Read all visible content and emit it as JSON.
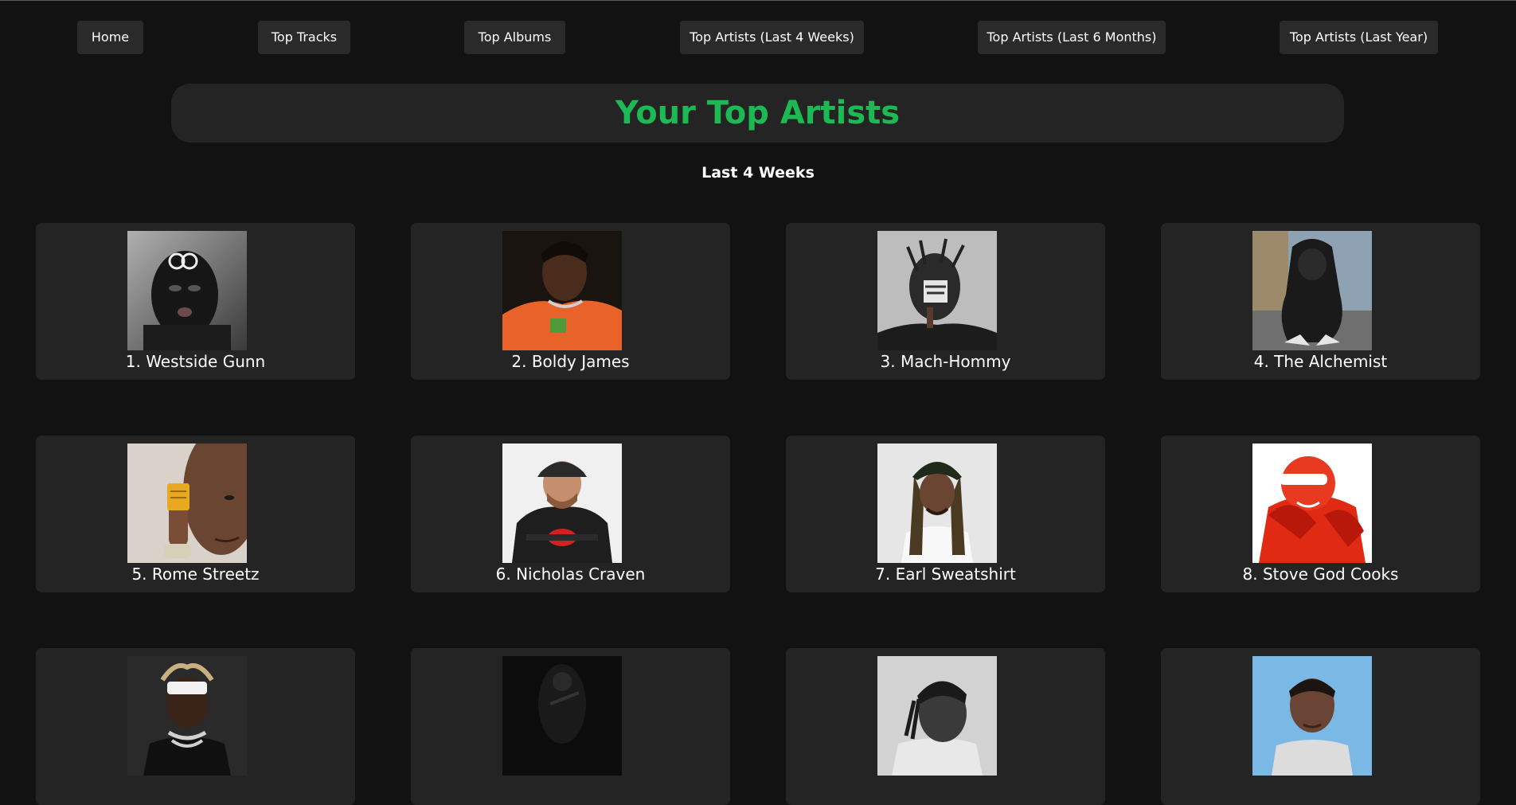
{
  "nav": {
    "home": "Home",
    "top_tracks": "Top Tracks",
    "top_albums": "Top Albums",
    "top_artists_4w": "Top Artists (Last 4 Weeks)",
    "top_artists_6m": "Top Artists (Last 6 Months)",
    "top_artists_year": "Top Artists (Last Year)"
  },
  "header": {
    "title": "Your Top Artists",
    "subtitle": "Last 4 Weeks"
  },
  "colors": {
    "accent": "#1db954",
    "background": "#121212",
    "card": "#242424"
  },
  "artists": [
    {
      "label": "1. Westside Gunn"
    },
    {
      "label": "2. Boldy James"
    },
    {
      "label": "3. Mach-Hommy"
    },
    {
      "label": "4. The Alchemist"
    },
    {
      "label": "5. Rome Streetz"
    },
    {
      "label": "6. Nicholas Craven"
    },
    {
      "label": "7. Earl Sweatshirt"
    },
    {
      "label": "8. Stove God Cooks"
    },
    {
      "label": ""
    },
    {
      "label": ""
    },
    {
      "label": ""
    },
    {
      "label": ""
    }
  ]
}
